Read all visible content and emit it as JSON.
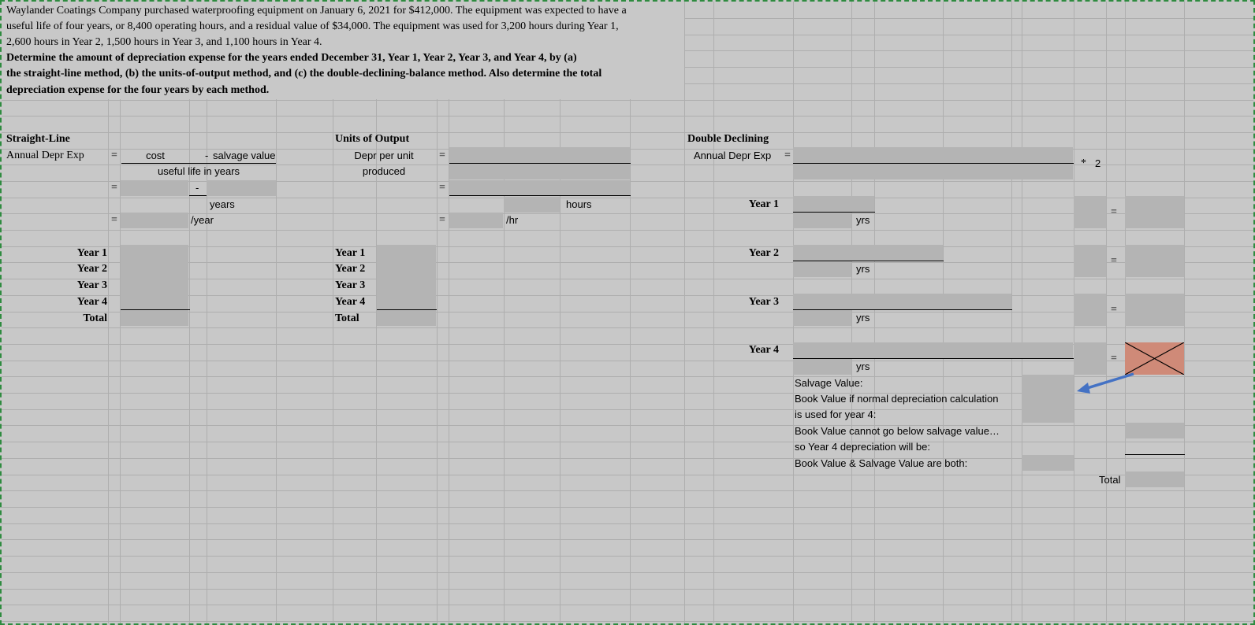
{
  "problem": {
    "line1": "Waylander Coatings Company purchased waterproofing equipment on January 6, 2021 for $412,000. The equipment was expected to have a",
    "line2": "useful life of four years, or 8,400 operating hours, and a residual value of $34,000. The equipment was used for 3,200 hours during Year 1,",
    "line3": "2,600 hours in Year 2, 1,500 hours in Year 3, and 1,100 hours in Year 4.",
    "bold1": "Determine the amount of depreciation expense for the years ended December 31, Year 1, Year 2, Year 3, and Year 4, by (a)",
    "bold2": "the straight-line method, (b) the units-of-output method, and (c) the double-declining-balance method. Also determine the total",
    "bold3": "depreciation expense for the four years by each method."
  },
  "straight_line": {
    "title": "Straight-Line",
    "annual": "Annual Depr Exp",
    "eq": "=",
    "cost": "cost",
    "minus": "-",
    "salvage": "salvage value",
    "useful": "useful life in years",
    "years": "years",
    "per_year": "/year",
    "rows": [
      "Year 1",
      "Year 2",
      "Year 3",
      "Year 4"
    ],
    "total": "Total"
  },
  "units_output": {
    "title": "Units of Output",
    "depr1": "Depr per unit",
    "depr2": "produced",
    "eq": "=",
    "hours": "hours",
    "per_hr": "/hr",
    "rows": [
      "Year 1",
      "Year 2",
      "Year 3",
      "Year 4"
    ],
    "total": "Total"
  },
  "double_declining": {
    "title": "Double Declining",
    "annual": "Annual Depr Exp",
    "eq": "=",
    "times": "*",
    "two": "2",
    "years": [
      "Year 1",
      "Year 2",
      "Year 3",
      "Year 4"
    ],
    "yrs": "yrs",
    "salvage": "Salvage Value:",
    "bv1": "Book Value if normal depreciation calculation",
    "bv2": "is used for year 4:",
    "cannot": "Book Value cannot go below salvage value…",
    "so": "so Year 4 depreciation will be:",
    "both": "Book Value & Salvage Value are both:",
    "total": "Total"
  },
  "colors": {
    "sheet_bg": "#c8c8c8",
    "input_cell": "#b4b4b4",
    "crossed_cell": "#cf8a78",
    "arrow": "#4472c4",
    "border": "#2e8b3f"
  }
}
